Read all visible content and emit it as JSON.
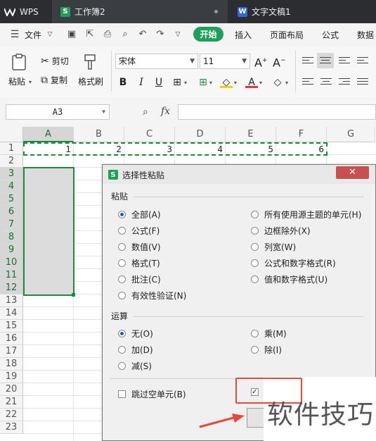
{
  "tabs": {
    "wps": "WPS",
    "workbook": "工作簿2",
    "document": "文字文稿1"
  },
  "menu": {
    "file": "文件",
    "start": "开始",
    "insert": "插入",
    "page_layout": "页面布局",
    "formula": "公式",
    "data": "数据"
  },
  "ribbon": {
    "paste": "粘贴",
    "cut": "剪切",
    "copy": "复制",
    "format_painter": "格式刷",
    "font_name": "宋体",
    "font_size": "11",
    "grow_font": "A",
    "shrink_font": "A",
    "bold": "B",
    "italic": "I",
    "underline": "U",
    "font_color": "A"
  },
  "formula_bar": {
    "name_box": "A3",
    "fx": "fx",
    "content": ""
  },
  "grid": {
    "columns": [
      "A",
      "B",
      "C",
      "D",
      "E",
      "F",
      "G"
    ],
    "rows": [
      "1",
      "2",
      "3",
      "4",
      "5",
      "6",
      "7",
      "8",
      "9",
      "10",
      "11",
      "12",
      "13",
      "14",
      "15",
      "16",
      "17",
      "18",
      "19",
      "20",
      "21",
      "22",
      "23"
    ],
    "row1_values": [
      "1",
      "2",
      "3",
      "4",
      "5",
      "6"
    ]
  },
  "dialog": {
    "title": "选择性粘贴",
    "paste_group": "粘贴",
    "paste_options": {
      "all": "全部(A)",
      "formulas": "公式(F)",
      "values": "数值(V)",
      "formats": "格式(T)",
      "comments": "批注(C)",
      "validation": "有效性验证(N)",
      "theme_cells": "所有使用源主题的单元(H)",
      "except_borders": "边框除外(X)",
      "column_widths": "列宽(W)",
      "formulas_numbers": "公式和数字格式(R)",
      "values_numbers": "值和数字格式(U)"
    },
    "operation_group": "运算",
    "operation_options": {
      "none": "无(O)",
      "add": "加(D)",
      "subtract": "减(S)",
      "multiply": "乘(M)",
      "divide": "除(I)"
    },
    "skip_blanks": "跳过空单元(B)",
    "close": "✕"
  },
  "watermark": "软件技巧",
  "colors": {
    "accent_green": "#1fa05a",
    "selection_green": "#1f8a3d",
    "highlight_red": "#e8473a",
    "close_red": "#c75050"
  }
}
